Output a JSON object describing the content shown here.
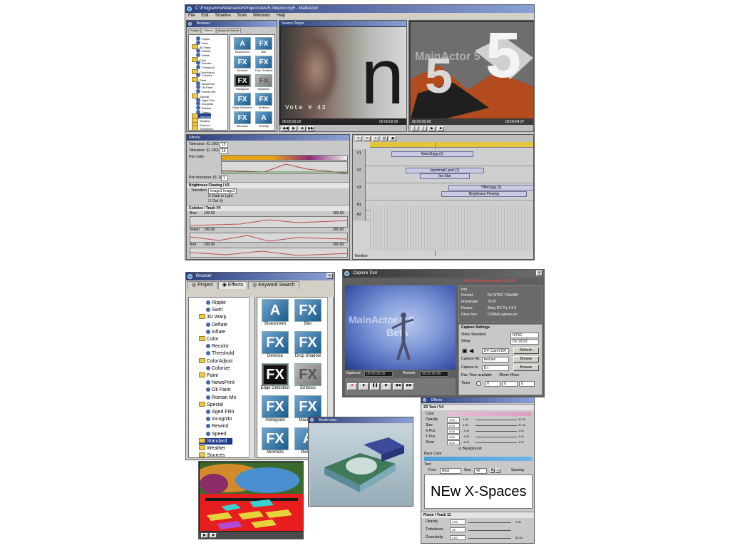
{
  "screenshot_top": {
    "title": "C:\\Programme\\Mainactor\\Projects\\test5.0\\demo.mp5 - MainActor",
    "menu": [
      "File",
      "Edit",
      "Timeline",
      "Tools",
      "Windows",
      "Help"
    ],
    "browser": {
      "title": "Browser",
      "tabs": [
        "Project",
        "Effects",
        "Keyword Search"
      ],
      "tree": [
        "Ripple",
        "Swirl",
        "3D Warp",
        "Deflate",
        "Inflate",
        "Color",
        "Recolor",
        "Threshold",
        "ColorAdjust",
        "Colorize",
        "Paint",
        "NewsPrint",
        "Oil Paint",
        "Romen Mo",
        "Special",
        "Aged Film",
        "Incognito",
        "Rewind",
        "Speed",
        "Standard",
        "Weather",
        "Sources",
        "Transitions"
      ],
      "effects": [
        {
          "glyph": "A",
          "label": "Bluescreen",
          "style": "blue"
        },
        {
          "glyph": "FX",
          "label": "Blur",
          "style": "blue"
        },
        {
          "glyph": "FX",
          "label": "Denoise",
          "style": "blue"
        },
        {
          "glyph": "FX",
          "label": "Drop Shadow",
          "style": "blue"
        },
        {
          "glyph": "FX",
          "label": "Histogram",
          "style": "dark"
        },
        {
          "glyph": "FX",
          "label": "Maximize",
          "style": "grey"
        },
        {
          "glyph": "FX",
          "label": "Edge Detection",
          "style": "blue"
        },
        {
          "glyph": "FX",
          "label": "Emboss",
          "style": "blue"
        },
        {
          "glyph": "FX",
          "label": "Minimize",
          "style": "blue"
        },
        {
          "glyph": "A",
          "label": "Overlay",
          "style": "blue"
        }
      ]
    },
    "source_player": {
      "title": "Source Player",
      "overlay_text": "Vote # 43",
      "big_letter": "n",
      "timecodes": [
        "00:00:00.00",
        "00:00:02.00"
      ]
    },
    "preview": {
      "watermark": "MainActor 5",
      "big_numbers": [
        "5",
        "5"
      ],
      "timecodes": [
        "00:00:00.00",
        "00:00:04.07"
      ]
    },
    "effects_panel": {
      "title": "Effects",
      "rows": [
        {
          "label": "Tolerance: (0..100)",
          "value": "15"
        },
        {
          "label": "Tolerance: (0..100)",
          "value": "15"
        },
        {
          "label": "Pen color",
          "value": ""
        },
        {
          "label": "Pen thickness: (0..10.0)",
          "value": "1"
        }
      ],
      "section_brightness": "Brightness Flowing / V3",
      "transition_label": "Transition",
      "transition_value": "Image1 Image2",
      "checkbox_dark": "Dark to Light",
      "checkbox_out": "Out Vy",
      "section_colorize": "Colorize / Track V4",
      "channels": [
        {
          "name": "Blue",
          "v1": "100.00",
          "v2": "200.00"
        },
        {
          "name": "Green",
          "v1": "100.00",
          "v2": "200.00"
        },
        {
          "name": "Red",
          "v1": "100.00",
          "v2": "200.00"
        }
      ]
    },
    "timeline": {
      "tracks": [
        "V1",
        "V2",
        "V3",
        "A1",
        "A2"
      ],
      "clips": [
        {
          "track": 0,
          "label": "Nebel3.jpg (1)"
        },
        {
          "track": 1,
          "label": "layermap1.psd (1)"
        },
        {
          "track": 1,
          "label": "Iris Star"
        },
        {
          "track": 2,
          "label": "Tiffel3.jpg (1)"
        },
        {
          "track": 2,
          "label": "Brightness Flowing"
        }
      ],
      "footer": "Timeline"
    }
  },
  "browser_large": {
    "title": "Browser",
    "tabs": [
      "Project",
      "Effects",
      "Keyword Search"
    ],
    "tree": [
      {
        "text": "Ripple",
        "type": "leaf"
      },
      {
        "text": "Swirl",
        "type": "leaf"
      },
      {
        "text": "3D Warp",
        "type": "folder"
      },
      {
        "text": "Deflate",
        "type": "leaf"
      },
      {
        "text": "Inflate",
        "type": "leaf"
      },
      {
        "text": "Color",
        "type": "folder"
      },
      {
        "text": "Recolor",
        "type": "leaf"
      },
      {
        "text": "Threshold",
        "type": "leaf"
      },
      {
        "text": "ColorAdjust",
        "type": "folder"
      },
      {
        "text": "Colorize",
        "type": "leaf"
      },
      {
        "text": "Paint",
        "type": "folder"
      },
      {
        "text": "NewsPrint",
        "type": "leaf"
      },
      {
        "text": "Oil Paint",
        "type": "leaf"
      },
      {
        "text": "Roman Mo",
        "type": "leaf"
      },
      {
        "text": "Special",
        "type": "folder"
      },
      {
        "text": "Aged Film",
        "type": "leaf"
      },
      {
        "text": "Incognito",
        "type": "leaf"
      },
      {
        "text": "Rewind",
        "type": "leaf"
      },
      {
        "text": "Speed",
        "type": "leaf"
      },
      {
        "text": "Standard",
        "type": "folder",
        "selected": true
      },
      {
        "text": "Weather",
        "type": "folder"
      },
      {
        "text": "Sources",
        "type": "folder"
      }
    ],
    "effects": [
      {
        "glyph": "A",
        "label": "Bluescreen",
        "style": "blue"
      },
      {
        "glyph": "FX",
        "label": "Blur",
        "style": "blue"
      },
      {
        "glyph": "FX",
        "label": "Denoise",
        "style": "blue"
      },
      {
        "glyph": "FX",
        "label": "Drop Shadow",
        "style": "blue"
      },
      {
        "glyph": "FX",
        "label": "Edge Detection",
        "style": "dark"
      },
      {
        "glyph": "FX",
        "label": "Emboss",
        "style": "grey"
      },
      {
        "glyph": "FX",
        "label": "Histogram",
        "style": "blue"
      },
      {
        "glyph": "FX",
        "label": "Maximize",
        "style": "blue"
      },
      {
        "glyph": "FX",
        "label": "Minimize",
        "style": "blue"
      },
      {
        "glyph": "A",
        "label": "Overlay",
        "style": "blue"
      }
    ]
  },
  "capture_tool": {
    "title": "Capture Tool",
    "record_time": "Record time remaining: 00:25:45",
    "watermark_line1": "MainActor 5.0",
    "watermark_line2": "Beta",
    "info_header": "Info",
    "info": [
      {
        "k": "Format:",
        "v": "DV NTSC 720x480"
      },
      {
        "k": "Framerate:",
        "v": "29.97"
      },
      {
        "k": "Device:",
        "v": "Sony DV Fly 1.5.0"
      },
      {
        "k": "Drive free:",
        "v": "0.24h/Ecapture.avi"
      }
    ],
    "settings_header": "Capture Settings",
    "video_standard_label": "Video Standard",
    "video_standard_value": "NTSC",
    "setup_label": "Setup",
    "setup_value": "DV 29.97",
    "device_value": "DV Cam/VCR",
    "refresh_label": "Refresh",
    "capture_file_label": "Capture file",
    "capture_file_value": "test.avi",
    "capture_to_label": "Capture to",
    "capture_to_value": "E:\\",
    "browse_label": "Browse",
    "disc_time_label": "Disc Time available",
    "disc_time_value": "25min 45sec",
    "timer_label": "Timer",
    "timer_values": [
      "0",
      "0",
      "0"
    ],
    "captured_label": "Captured",
    "captured_value": "00:00:00.00",
    "remote_label": "Remote",
    "remote_value": "00:02:00.00"
  },
  "effects_text": {
    "title": "Effects",
    "section_text": "2D Text / V4",
    "rows": [
      {
        "name": "Color",
        "value": ""
      },
      {
        "name": "Opacity",
        "value": "1.00"
      },
      {
        "name": "Size",
        "value": "0.00"
      },
      {
        "name": "X Pos",
        "value": "0.00"
      },
      {
        "name": "Y Pos",
        "value": "0.50"
      },
      {
        "name": "Skew",
        "value": "0.00"
      }
    ],
    "range_left": [
      "1.00",
      "0.00",
      "-1.00",
      "-1.00",
      "-1.00",
      "-45.00"
    ],
    "range_right": [
      "41.00",
      "41.00",
      "1.00",
      "1.00",
      "1.00",
      "45.00"
    ],
    "background_checkbox": "Background",
    "back_color_label": "Back Color",
    "text_label": "Text",
    "font_label": "Font",
    "font_value": "Arial",
    "size_label": "Size",
    "size_value": "42",
    "spacing_label": "Spacing",
    "sample_text": "NEw X-Spaces",
    "section_flame": "Flame / Track 11",
    "flame_rows": [
      {
        "name": "Opacity",
        "v1": "0.00",
        "v2": "1.00"
      },
      {
        "name": "Turbulence",
        "v1": "15",
        "v2": ""
      },
      {
        "name": "Granularity",
        "v1": "4.00",
        "v2": "32.00"
      }
    ]
  },
  "viewer_3d": {
    "title": "Model view"
  }
}
